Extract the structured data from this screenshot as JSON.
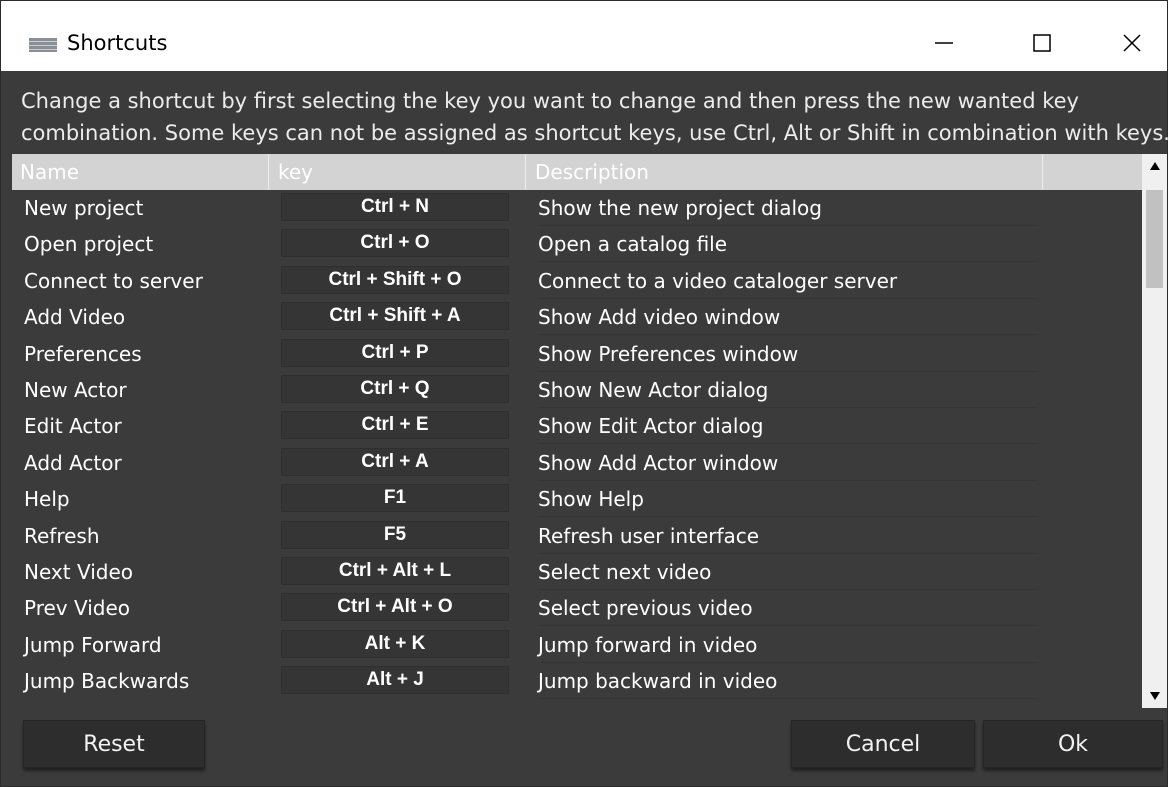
{
  "window": {
    "title": "Shortcuts",
    "icon": "app-window-icon",
    "controls": [
      "minimize-icon",
      "maximize-icon",
      "close-icon"
    ]
  },
  "hint": {
    "line1": "Change a shortcut by first selecting the key you want to change and then press the new wanted key",
    "line2": "combination. Some keys can not be assigned as shortcut keys, use Ctrl, Alt or Shift in combination with keys."
  },
  "table": {
    "columns": [
      "Name",
      "key",
      "Description",
      ""
    ],
    "rows": [
      {
        "name": "New project",
        "key": "Ctrl + N",
        "description": "Show the new project dialog"
      },
      {
        "name": "Open project",
        "key": "Ctrl + O",
        "description": "Open a catalog file"
      },
      {
        "name": "Connect to server",
        "key": "Ctrl + Shift + O",
        "description": "Connect to a video cataloger server"
      },
      {
        "name": "Add Video",
        "key": "Ctrl + Shift + A",
        "description": "Show Add video window"
      },
      {
        "name": "Preferences",
        "key": "Ctrl + P",
        "description": "Show Preferences window"
      },
      {
        "name": "New Actor",
        "key": "Ctrl + Q",
        "description": "Show New Actor dialog"
      },
      {
        "name": "Edit Actor",
        "key": "Ctrl + E",
        "description": "Show Edit Actor dialog"
      },
      {
        "name": "Add Actor",
        "key": "Ctrl + A",
        "description": "Show Add Actor window"
      },
      {
        "name": "Help",
        "key": "F1",
        "description": "Show Help"
      },
      {
        "name": "Refresh",
        "key": "F5",
        "description": "Refresh user interface"
      },
      {
        "name": "Next Video",
        "key": "Ctrl + Alt + L",
        "description": "Select next video"
      },
      {
        "name": "Prev Video",
        "key": "Ctrl + Alt + O",
        "description": "Select previous video"
      },
      {
        "name": "Jump Forward",
        "key": "Alt + K",
        "description": "Jump forward in video"
      },
      {
        "name": "Jump Backwards",
        "key": "Alt + J",
        "description": "Jump backward in video"
      }
    ]
  },
  "buttons": {
    "reset": "Reset",
    "cancel": "Cancel",
    "ok": "Ok"
  },
  "colors": {
    "background": "#3b3b3b",
    "header": "#d3d3d3",
    "button": "#2d2d2d",
    "key_cell": "#353535"
  }
}
